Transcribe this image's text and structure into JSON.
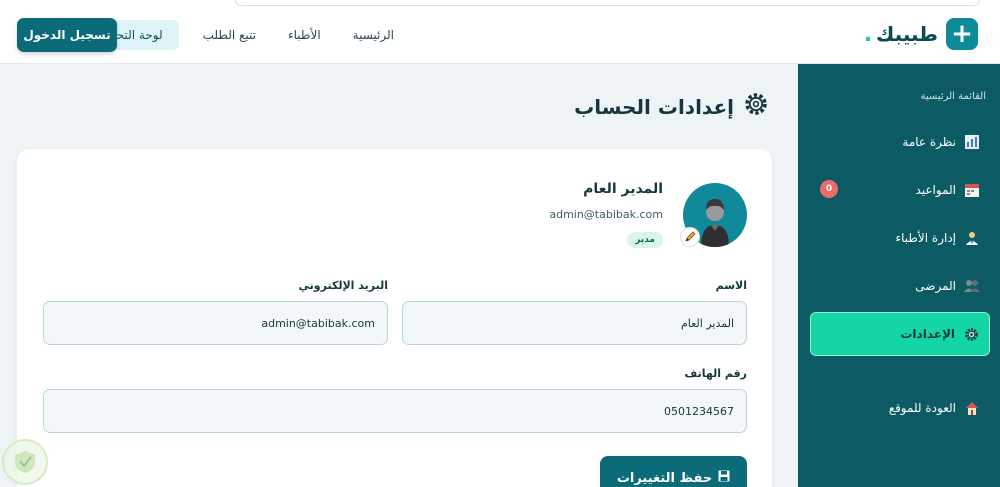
{
  "header": {
    "brand_name": "طبيبك",
    "brand_dot": ".",
    "nav": [
      "الرئيسية",
      "الأطباء",
      "تتبع الطلب",
      "لوحة التحكم"
    ],
    "login_label": "تسجيل الدخول"
  },
  "sidebar": {
    "heading": "القائمة الرئيسية",
    "items": [
      {
        "label": "نظرة عامة",
        "icon": "chart-icon"
      },
      {
        "label": "المواعيد",
        "icon": "calendar-icon",
        "badge": "0"
      },
      {
        "label": "إدارة الأطباء",
        "icon": "doctor-icon"
      },
      {
        "label": "المرضى",
        "icon": "users-icon"
      },
      {
        "label": "الإعدادات",
        "icon": "gear-icon"
      },
      {
        "label": "العودة للموقع",
        "icon": "home-icon"
      }
    ]
  },
  "main": {
    "title": "إعدادات الحساب",
    "profile": {
      "name": "المدير العام",
      "email": "admin@tabibak.com",
      "role": "مدير"
    },
    "form": {
      "name_label": "الاسم",
      "name_value": "المدير العام",
      "email_label": "البريد الإلكتروني",
      "email_value": "admin@tabibak.com",
      "phone_label": "رقم الهاتف",
      "phone_value": "0501234567",
      "save_label": "حفظ التغييرات"
    }
  },
  "colors": {
    "primary": "#0b6b78",
    "sidebar": "#0c5a63",
    "accent": "#14d6a4",
    "background": "#eef4f6"
  }
}
